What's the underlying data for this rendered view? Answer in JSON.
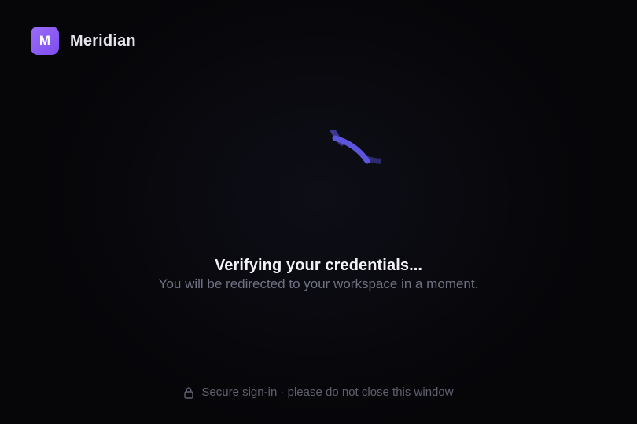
{
  "brand": {
    "logo_letter": "M",
    "name": "Meridian",
    "logo_color": "#8b5cf6"
  },
  "loading": {
    "spinner_icon": "loading-spinner-icon",
    "spinner_color": "#5b55d6",
    "title": "Verifying your credentials...",
    "subtitle": "You will be redirected to your workspace in a moment."
  },
  "footer": {
    "icon": "lock-icon",
    "text": "Secure sign-in · please do not close this window"
  }
}
